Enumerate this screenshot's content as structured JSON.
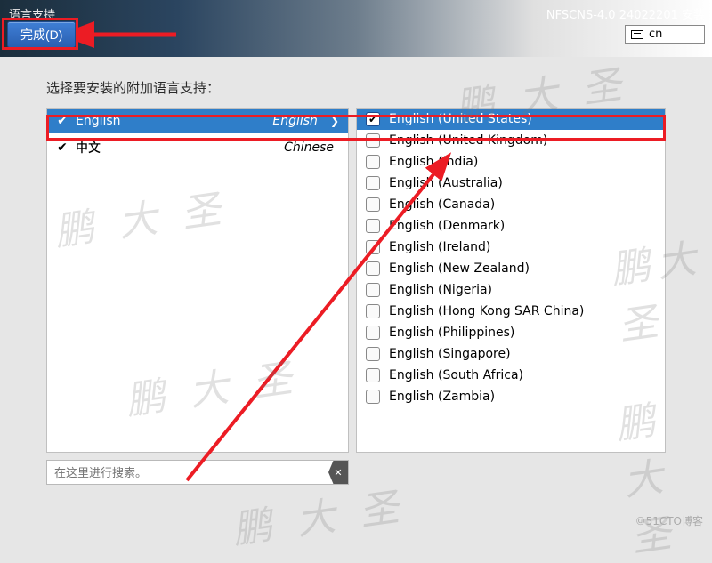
{
  "header": {
    "title": "语言支持",
    "version": "NFSCNS-4.0 24022201 安装",
    "done_label": "完成(D)",
    "kbd_layout": "cn"
  },
  "prompt": "选择要安装的附加语言支持：",
  "languages": [
    {
      "name": "English",
      "native": "English",
      "checked": true,
      "selected": true
    },
    {
      "name": "中文",
      "native": "Chinese",
      "checked": true,
      "selected": false
    }
  ],
  "locales": [
    {
      "label": "English (United States)",
      "checked": true,
      "selected": true
    },
    {
      "label": "English (United Kingdom)",
      "checked": false,
      "selected": false
    },
    {
      "label": "English (India)",
      "checked": false,
      "selected": false
    },
    {
      "label": "English (Australia)",
      "checked": false,
      "selected": false
    },
    {
      "label": "English (Canada)",
      "checked": false,
      "selected": false
    },
    {
      "label": "English (Denmark)",
      "checked": false,
      "selected": false
    },
    {
      "label": "English (Ireland)",
      "checked": false,
      "selected": false
    },
    {
      "label": "English (New Zealand)",
      "checked": false,
      "selected": false
    },
    {
      "label": "English (Nigeria)",
      "checked": false,
      "selected": false
    },
    {
      "label": "English (Hong Kong SAR China)",
      "checked": false,
      "selected": false
    },
    {
      "label": "English (Philippines)",
      "checked": false,
      "selected": false
    },
    {
      "label": "English (Singapore)",
      "checked": false,
      "selected": false
    },
    {
      "label": "English (South Africa)",
      "checked": false,
      "selected": false
    },
    {
      "label": "English (Zambia)",
      "checked": false,
      "selected": false
    }
  ],
  "search": {
    "placeholder": "在这里进行搜索。"
  },
  "watermark_text": "鹏大圣",
  "footer": "©51CTO博客"
}
